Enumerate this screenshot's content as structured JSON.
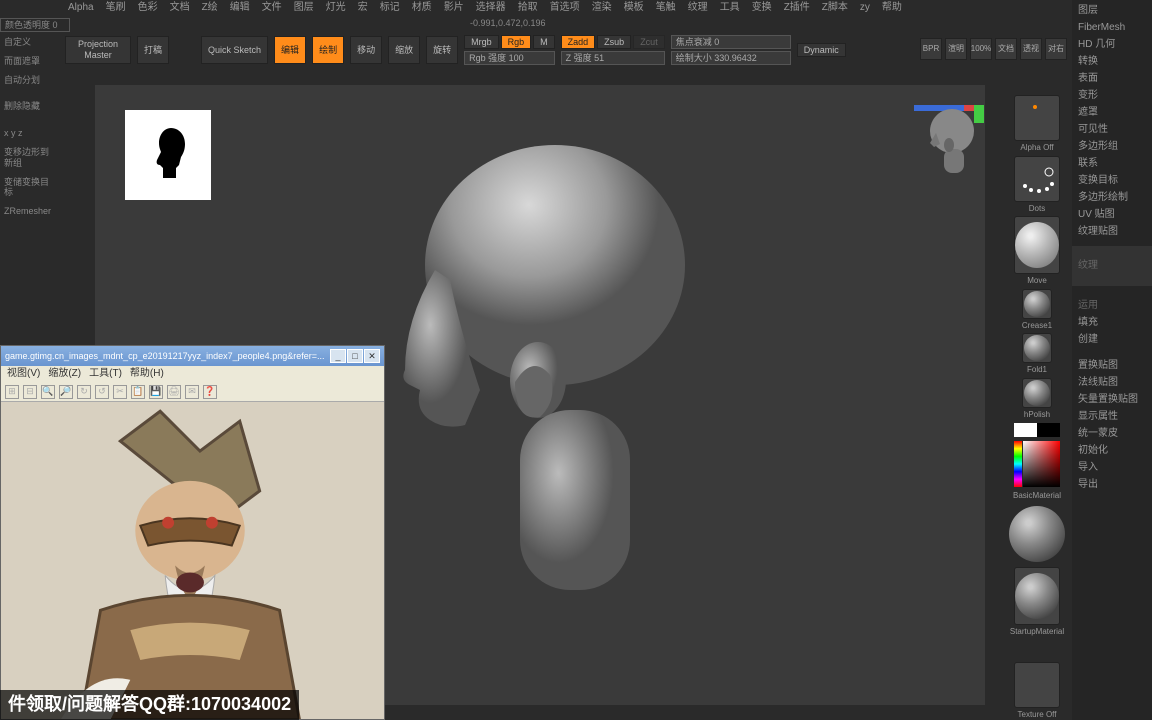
{
  "menubar": [
    "Alpha",
    "笔刷",
    "色彩",
    "文档",
    "Z绘",
    "编辑",
    "文件",
    "图层",
    "灯光",
    "宏",
    "标记",
    "材质",
    "影片",
    "选择器",
    "拾取",
    "首选项",
    "渲染",
    "模板",
    "笔触",
    "纹理",
    "工具",
    "变换",
    "Z插件",
    "Z脚本",
    "zy",
    "帮助"
  ],
  "lefttools": {
    "opacity": "颜色透明度 0",
    "items": [
      "自定义",
      "而面遮罩",
      "自动分划",
      "",
      "删除隐藏",
      "",
      "x y z",
      "变移边形到新组",
      "变储变换目标",
      "ZRemesher"
    ]
  },
  "shelf": {
    "projection": "Projection Master",
    "daqiao": "打稿",
    "quick": "Quick Sketch",
    "edit": "编辑",
    "draw": "绘制",
    "move": "移动",
    "scale": "缩放",
    "rotate": "旋转",
    "mrgb": "Mrgb",
    "rgb": "Rgb",
    "m": "M",
    "rgbint": "Rgb 强度 100",
    "zadd": "Zadd",
    "zsub": "Zsub",
    "zcut": "Zcut",
    "zint": "Z 强度 51",
    "focal": "焦点衰减 0",
    "drawsize": "绘制大小 330.96432",
    "dynamic": "Dynamic"
  },
  "coords": "-0.991,0.472,0.196",
  "topright": [
    "BPR",
    "渲明",
    "100%",
    "文档",
    "透视",
    "对右"
  ],
  "rightshelf": {
    "alpha": "Alpha Off",
    "dots": "Dots",
    "move": "Move",
    "crease": "Crease1",
    "fold": "Fold1",
    "hpolish": "hPolish",
    "basicmat": "BasicMaterial",
    "startup": "StartupMaterial",
    "texoff": "Texture Off"
  },
  "rightmenu": {
    "items": [
      "图层",
      "FiberMesh",
      "HD 几何",
      "转换",
      "表面",
      "变形",
      "遮罩",
      "可见性",
      "多边形组",
      "联系",
      "变换目标",
      "多边形绘制",
      "UV 贴图",
      "纹理贴图"
    ],
    "sub": "纹理",
    "items2": [
      "填充",
      "创建"
    ],
    "items3": [
      "置换贴图",
      "法线贴图",
      "矢量置换贴图",
      "显示属性",
      "统一蒙皮",
      "初始化",
      "导入",
      "导出"
    ]
  },
  "refwin": {
    "title": "game.gtimg.cn_images_mdnt_cp_e20191217yyz_index7_people4.png&refer=...",
    "menu": [
      "视图(V)",
      "缩放(Z)",
      "工具(T)",
      "帮助(H)"
    ]
  },
  "watermark": "件领取/问题解答QQ群:1070034002"
}
